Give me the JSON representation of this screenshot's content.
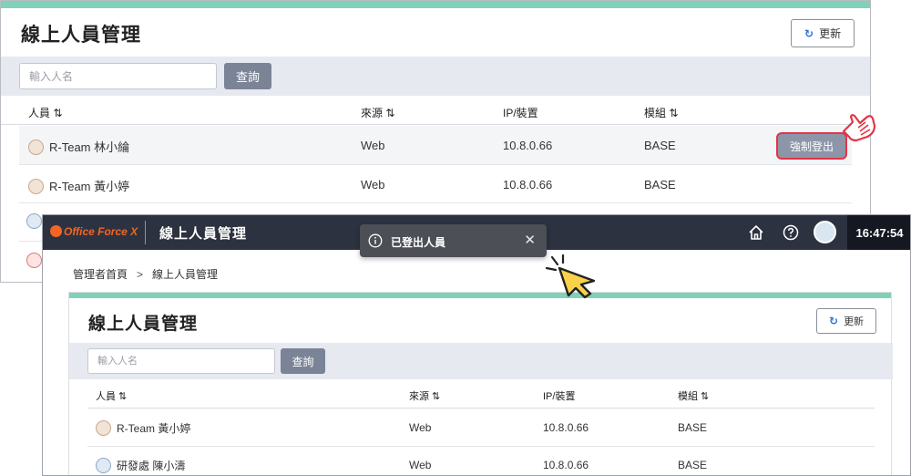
{
  "back": {
    "title": "線上人員管理",
    "refresh_label": "更新",
    "search_placeholder": "輸入人名",
    "query_label": "查詢",
    "columns": [
      "人員 ⇅",
      "來源 ⇅",
      "IP/裝置",
      "模組 ⇅"
    ],
    "rows": [
      {
        "person": "R-Team 林小綸",
        "source": "Web",
        "ip": "10.8.0.66",
        "module": "BASE",
        "action": "強制登出"
      },
      {
        "person": "R-Team 黃小婷",
        "source": "Web",
        "ip": "10.8.0.66",
        "module": "BASE"
      }
    ]
  },
  "front": {
    "brand": "Office Force X",
    "app_title": "線上人員管理",
    "clock": "16:47:54",
    "toast": {
      "message": "已登出人員"
    },
    "breadcrumb": [
      "管理者首頁",
      "線上人員管理"
    ],
    "card_title": "線上人員管理",
    "refresh_label": "更新",
    "search_placeholder": "輸入人名",
    "query_label": "查詢",
    "columns": [
      "人員 ⇅",
      "來源 ⇅",
      "IP/裝置",
      "模組 ⇅"
    ],
    "rows": [
      {
        "person": "R-Team 黃小婷",
        "source": "Web",
        "ip": "10.8.0.66",
        "module": "BASE"
      },
      {
        "person": "研發處 陳小濤",
        "source": "Web",
        "ip": "10.8.0.66",
        "module": "BASE"
      }
    ]
  },
  "colors": {
    "accent_bar": "#7fd1b8",
    "appbar": "#2d3241",
    "brand": "#f26522",
    "highlight": "#e53346"
  },
  "icons": [
    "refresh-icon",
    "home-icon",
    "help-icon",
    "info-icon",
    "close-icon",
    "hand-pointer-icon",
    "cursor-click-icon"
  ]
}
